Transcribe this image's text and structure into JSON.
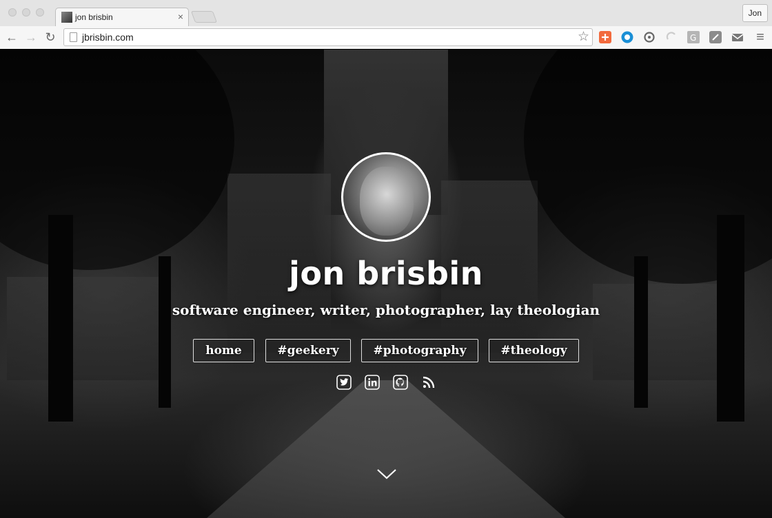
{
  "browser": {
    "tab_title": "jon brisbin",
    "tab_close": "×",
    "profile_name": "Jon",
    "url": "jbrisbin.com",
    "icons": {
      "back": "arrow-left-icon",
      "forward": "arrow-right-icon",
      "reload": "reload-icon",
      "bookmark": "star-icon",
      "menu": "hamburger-menu-icon"
    },
    "back_glyph": "←",
    "forward_glyph": "→",
    "reload_glyph": "↻",
    "star_glyph": "☆",
    "menu_glyph": "≡",
    "extensions": [
      {
        "name": "plus-extension-icon",
        "color": "#f26a3d"
      },
      {
        "name": "circle-extension-icon",
        "color": "#1a8fd6"
      },
      {
        "name": "sync-extension-icon",
        "color": "#777777"
      },
      {
        "name": "refresh-extension-icon",
        "color": "#cfcfcf"
      },
      {
        "name": "g-extension-icon",
        "color": "#9a9a9a"
      },
      {
        "name": "note-extension-icon",
        "color": "#888888"
      },
      {
        "name": "mail-extension-icon",
        "color": "#777777"
      }
    ]
  },
  "page": {
    "name": "jon brisbin",
    "tagline": "software engineer, writer, photographer, lay theologian",
    "nav": [
      {
        "label": "home"
      },
      {
        "label": "#geekery"
      },
      {
        "label": "#photography"
      },
      {
        "label": "#theology"
      }
    ],
    "social": [
      "twitter-icon",
      "linkedin-icon",
      "github-icon",
      "rss-icon"
    ],
    "scroll_hint": "chevron-down-icon"
  }
}
